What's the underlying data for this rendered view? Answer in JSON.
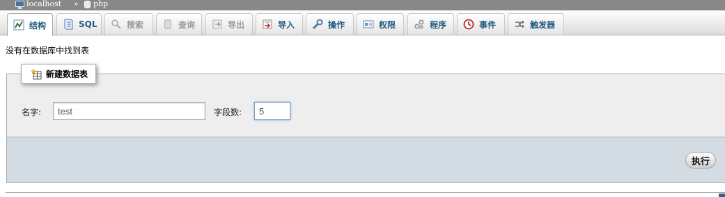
{
  "breadcrumb": {
    "server": "localhost",
    "separator": "»",
    "database": "php"
  },
  "tabs": [
    {
      "label": "结构",
      "icon": "structure-icon",
      "state": "active"
    },
    {
      "label": "SQL",
      "icon": "sql-icon",
      "state": "normal"
    },
    {
      "label": "搜索",
      "icon": "search-icon",
      "state": "disabled"
    },
    {
      "label": "查询",
      "icon": "query-icon",
      "state": "disabled"
    },
    {
      "label": "导出",
      "icon": "export-icon",
      "state": "disabled"
    },
    {
      "label": "导入",
      "icon": "import-icon",
      "state": "normal"
    },
    {
      "label": "操作",
      "icon": "operations-icon",
      "state": "normal"
    },
    {
      "label": "权限",
      "icon": "privileges-icon",
      "state": "normal"
    },
    {
      "label": "程序",
      "icon": "routines-icon",
      "state": "normal"
    },
    {
      "label": "事件",
      "icon": "events-icon",
      "state": "normal"
    },
    {
      "label": "触发器",
      "icon": "triggers-icon",
      "state": "normal"
    }
  ],
  "message": "没有在数据库中找到表",
  "create_table": {
    "legend": "新建数据表",
    "name_label": "名字:",
    "name_value": "test",
    "fields_label": "字段数:",
    "fields_value": "5",
    "submit_label": "执行"
  },
  "colors": {
    "tab_text": "#235a81",
    "disabled_text": "#999999",
    "fieldset_bg": "#eeeeee",
    "footer_bg": "#d3dce3"
  }
}
